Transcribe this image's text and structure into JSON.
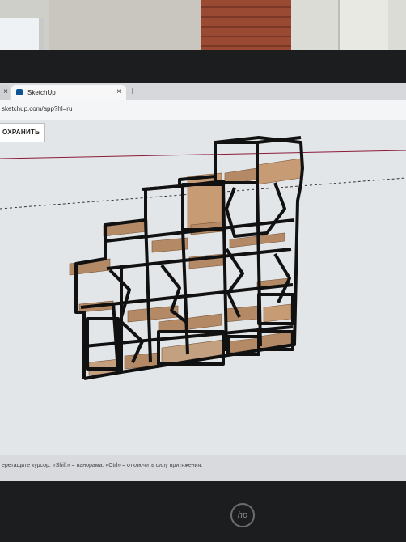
{
  "browser": {
    "tabs": [
      {
        "label": ""
      },
      {
        "label": "SketchUp"
      }
    ],
    "new_tab_symbol": "+",
    "close_symbol": "×",
    "url": "sketchup.com/app?hl=ru"
  },
  "toolbar": {
    "save_label": "ОХРАНИТЬ"
  },
  "status": {
    "message": "еретащите курсор. «Shift» = панорама. «Ctrl» = отключить силу притяжения."
  },
  "monitor": {
    "brand": "hp"
  },
  "icons": {
    "tab_favicon": "sketchup-icon",
    "new_tab": "plus-icon",
    "close": "close-icon"
  }
}
